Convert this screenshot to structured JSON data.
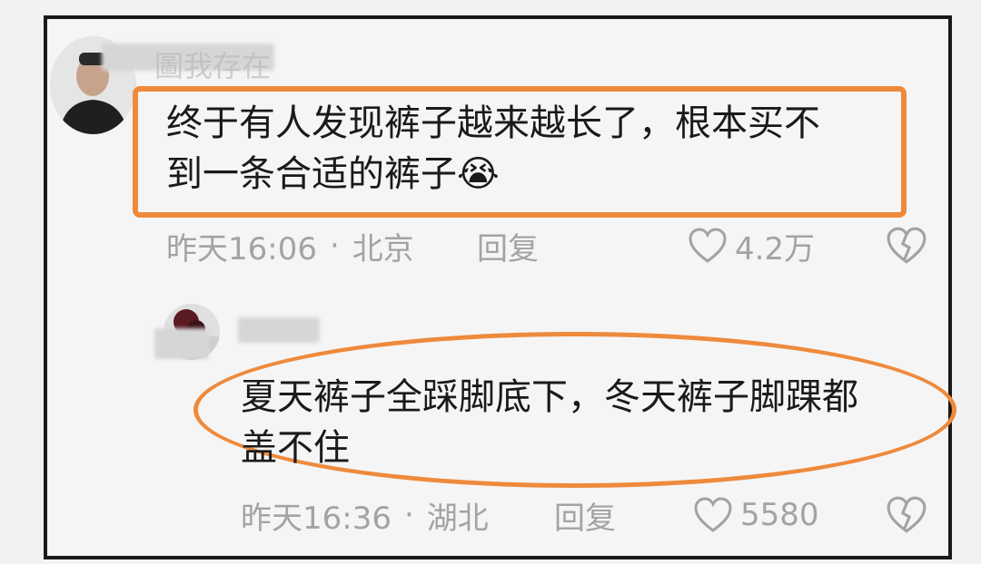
{
  "comments": [
    {
      "username": "圖我存在",
      "text_line1": "终于有人发现裤子越来越长了，根本买不",
      "text_line2": "到一条合适的裤子",
      "emoji": "😭",
      "time": "昨天16:06",
      "location": "北京",
      "reply_label": "回复",
      "likes": "4.2万"
    },
    {
      "username": "",
      "text_line1": "夏天裤子全踩脚底下，冬天裤子脚踝都",
      "text_line2": "盖不住",
      "time": "昨天16:36",
      "location": "湖北",
      "reply_label": "回复",
      "likes": "5580"
    }
  ],
  "separator": "·",
  "colors": {
    "highlight": "#ee8a3c",
    "text": "#1a1a1a",
    "meta": "#a3a3a3"
  },
  "icons": {
    "like": "heart-outline-icon",
    "dislike": "broken-heart-icon"
  }
}
